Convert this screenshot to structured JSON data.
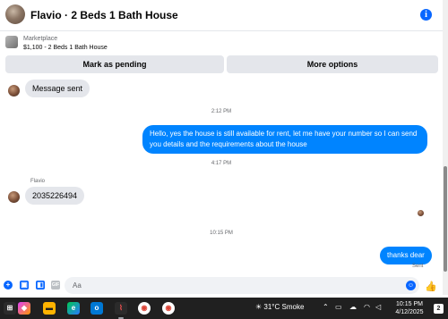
{
  "header": {
    "title": "Flavio · 2 Beds 1 Bath House",
    "info_icon": "info-icon"
  },
  "listing": {
    "source": "Marketplace",
    "summary": "$1,100 - 2 Beds 1 Bath House",
    "pending_label": "Mark as pending",
    "more_label": "More options"
  },
  "chat": {
    "messages": [
      {
        "text": "Message sent"
      },
      {
        "timestamp": "2:12 PM"
      },
      {
        "line1": "Hello, yes the house is still available for rent, let me have your number so I can send",
        "line2": "you details and the requirements about the house"
      },
      {
        "timestamp": "4:17 PM"
      },
      {
        "sender": "Flavio",
        "text": "2035226494"
      },
      {
        "timestamp": "10:15 PM"
      },
      {
        "text": "thanks dear",
        "status": "Sent"
      }
    ]
  },
  "composer": {
    "placeholder": "Aa",
    "icons": [
      "plus-icon",
      "photo-icon",
      "sticker-icon",
      "gif-icon",
      "emoji-icon",
      "like-icon"
    ]
  },
  "taskbar": {
    "weather": "31°C  Smoke",
    "time": "10:15 PM",
    "date": "4/12/2025",
    "notifications": "2",
    "colors": {
      "background": "#202020"
    }
  },
  "colors": {
    "accent": "#0866ff",
    "outgoing_bubble": "#0084ff",
    "incoming_bubble": "#e4e6eb"
  }
}
